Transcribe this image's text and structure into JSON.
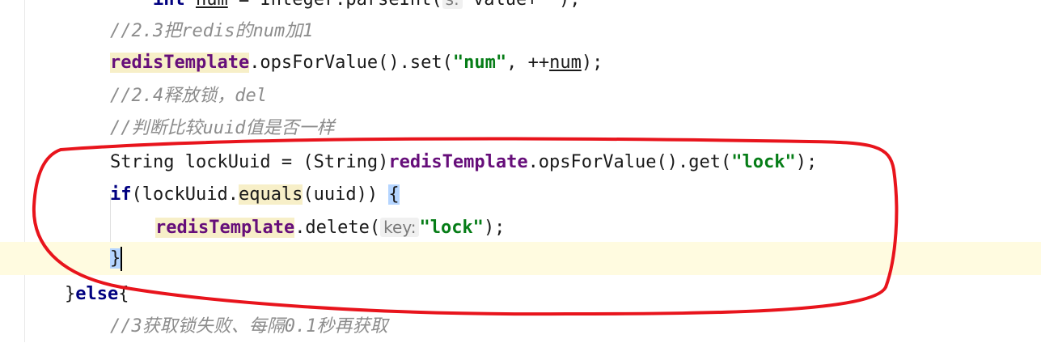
{
  "editor": {
    "lines": {
      "l0": {
        "kw": "int",
        "var": "num",
        "rest": " = Integer.parseInt(",
        "hint": "s:",
        "tail": " value+\"\");"
      },
      "l1": {
        "comment": "//2.3把redis的num加1"
      },
      "l2": {
        "field": "redisTemplate",
        "m1": ".opsForValue().set(",
        "str": "\"num\"",
        "m2": ", ++",
        "var": "num",
        "m3": ");"
      },
      "l3": {
        "comment": "//2.4释放锁，del"
      },
      "l4": {
        "comment": "//判断比较uuid值是否一样"
      },
      "l5": {
        "p1": "String lockUuid = (String)",
        "field": "redisTemplate",
        "p2": ".opsForValue().get(",
        "str": "\"lock\"",
        "p3": ");"
      },
      "l6": {
        "kw": "if",
        "p1": "(lockUuid.",
        "method": "equals",
        "p2": "(uuid)) ",
        "brace": "{"
      },
      "l7": {
        "field": "redisTemplate",
        "p1": ".delete(",
        "hint": "key:",
        "str": "\"lock\"",
        "p2": ");"
      },
      "l8": {
        "brace": "}"
      },
      "l9": {
        "p1": "}",
        "kw": "else",
        "p2": "{"
      },
      "l10": {
        "comment": "//3获取锁失败、每隔0.1秒再获取"
      }
    }
  },
  "annotation": {
    "color": "#e8141c",
    "shape": "hand-drawn-circle"
  }
}
